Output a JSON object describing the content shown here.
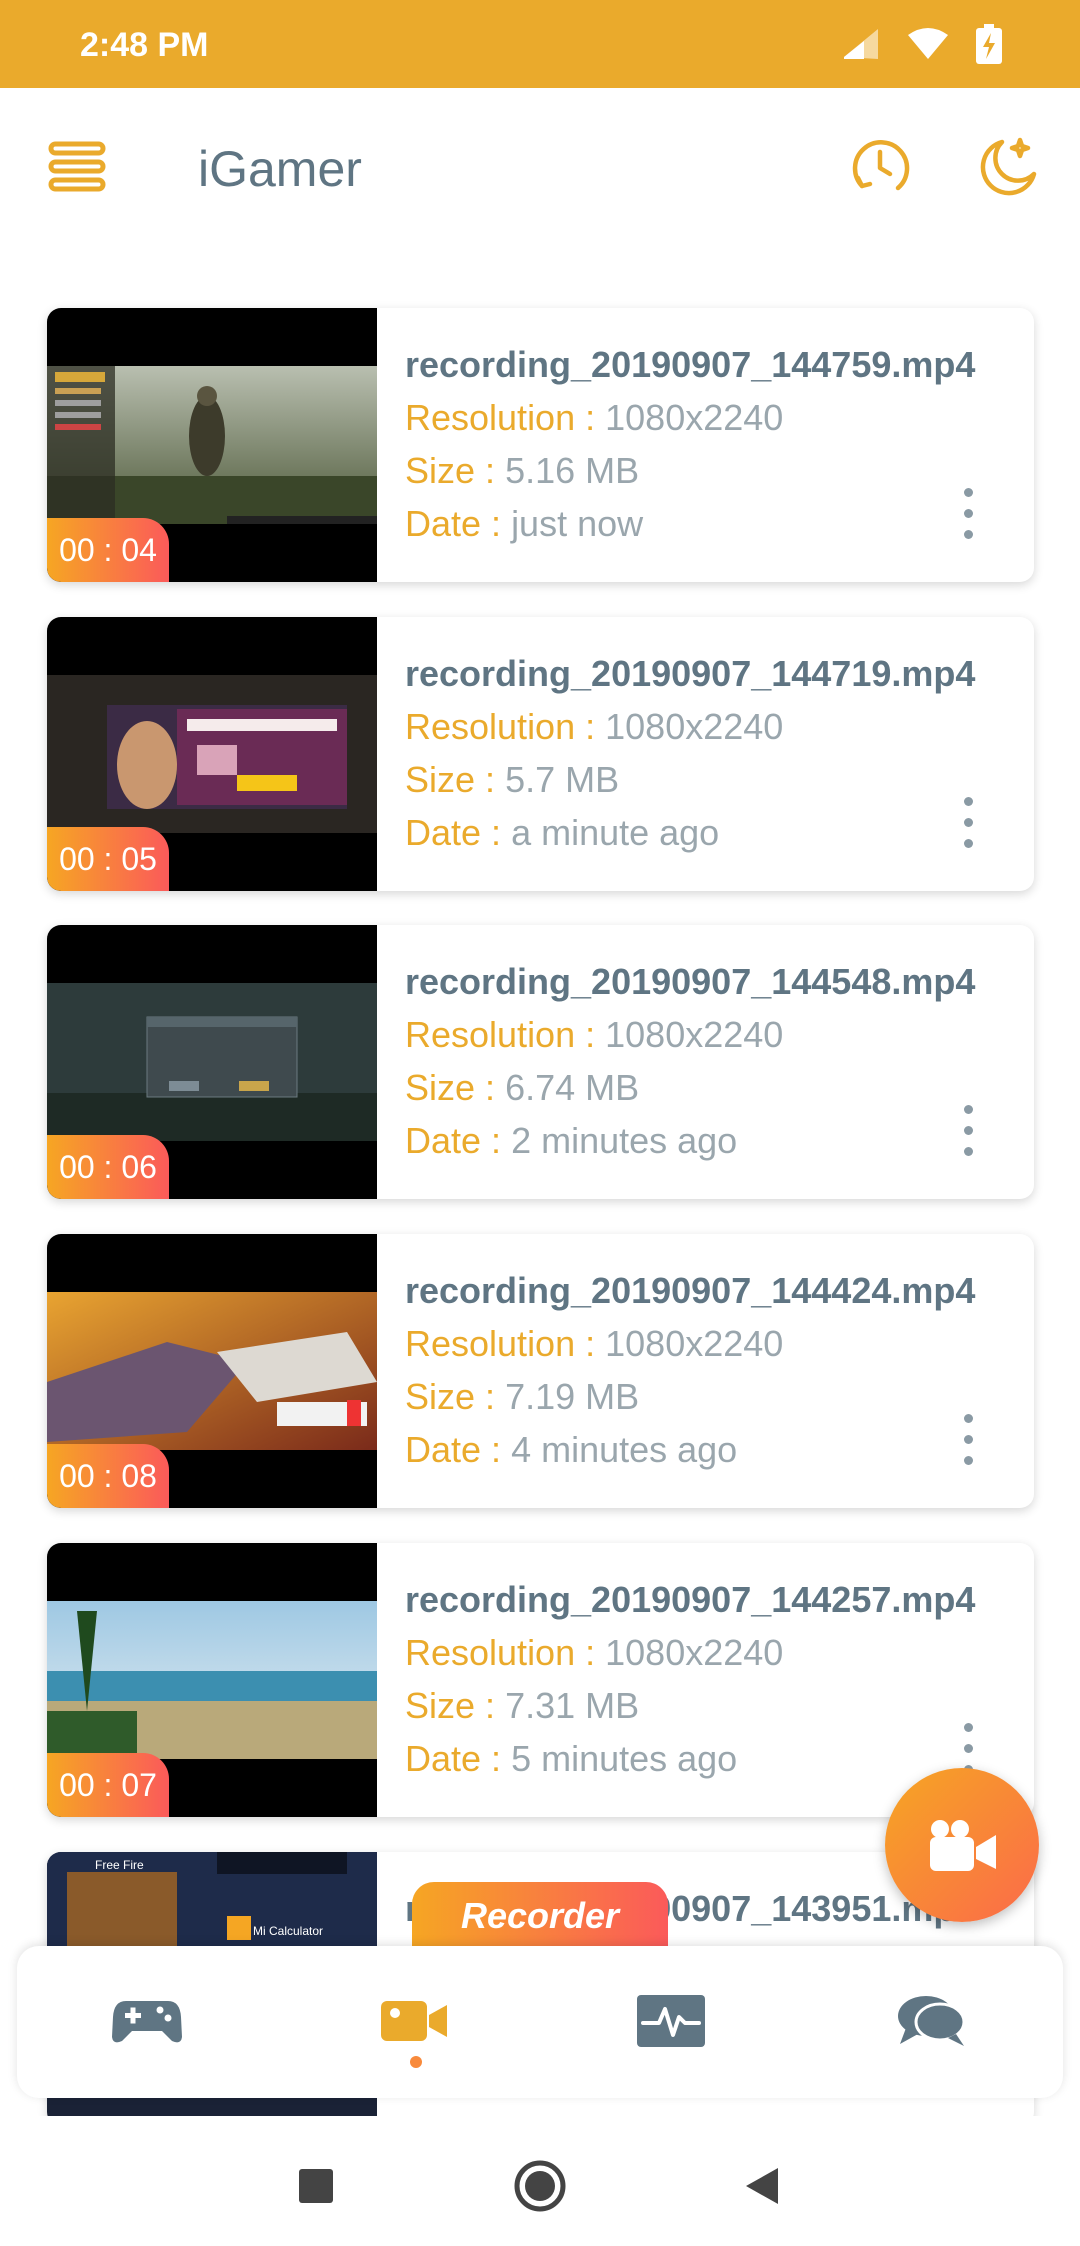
{
  "status": {
    "time": "2:48 PM"
  },
  "app": {
    "title": "iGamer"
  },
  "recordings": [
    {
      "file_name": "recording_20190907_144759.mp4",
      "resolution_label": "Resolution :",
      "resolution": "1080x2240",
      "size_label": "Size :",
      "size": "5.16 MB",
      "date_label": "Date :",
      "date": "just now",
      "duration": "00 : 04"
    },
    {
      "file_name": "recording_20190907_144719.mp4",
      "resolution_label": "Resolution :",
      "resolution": "1080x2240",
      "size_label": "Size :",
      "size": "5.7 MB",
      "date_label": "Date :",
      "date": "a minute ago",
      "duration": "00 : 05"
    },
    {
      "file_name": "recording_20190907_144548.mp4",
      "resolution_label": "Resolution :",
      "resolution": "1080x2240",
      "size_label": "Size :",
      "size": "6.74 MB",
      "date_label": "Date :",
      "date": "2 minutes ago",
      "duration": "00 : 06"
    },
    {
      "file_name": "recording_20190907_144424.mp4",
      "resolution_label": "Resolution :",
      "resolution": "1080x2240",
      "size_label": "Size :",
      "size": "7.19 MB",
      "date_label": "Date :",
      "date": "4 minutes ago",
      "duration": "00 : 08"
    },
    {
      "file_name": "recording_20190907_144257.mp4",
      "resolution_label": "Resolution :",
      "resolution": "1080x2240",
      "size_label": "Size :",
      "size": "7.31 MB",
      "date_label": "Date :",
      "date": "5 minutes ago",
      "duration": "00 : 07"
    },
    {
      "file_name": "recording_20190907_143951.mp4",
      "thumb_text_1": "Free Fire",
      "thumb_text_2": "Mi Calculator"
    }
  ],
  "recorder_tab_label": "Recorder",
  "nav": {
    "items": [
      {
        "icon": "gamepad-icon"
      },
      {
        "icon": "video-camera-icon",
        "active": true
      },
      {
        "icon": "activity-monitor-icon"
      },
      {
        "icon": "chat-icon"
      }
    ]
  },
  "colors": {
    "accent": "#EAAA2C",
    "gradient_start": "#F6A623",
    "gradient_end": "#FB5A5A",
    "text_title": "#5F7583",
    "text_value": "#9AA6AD"
  }
}
